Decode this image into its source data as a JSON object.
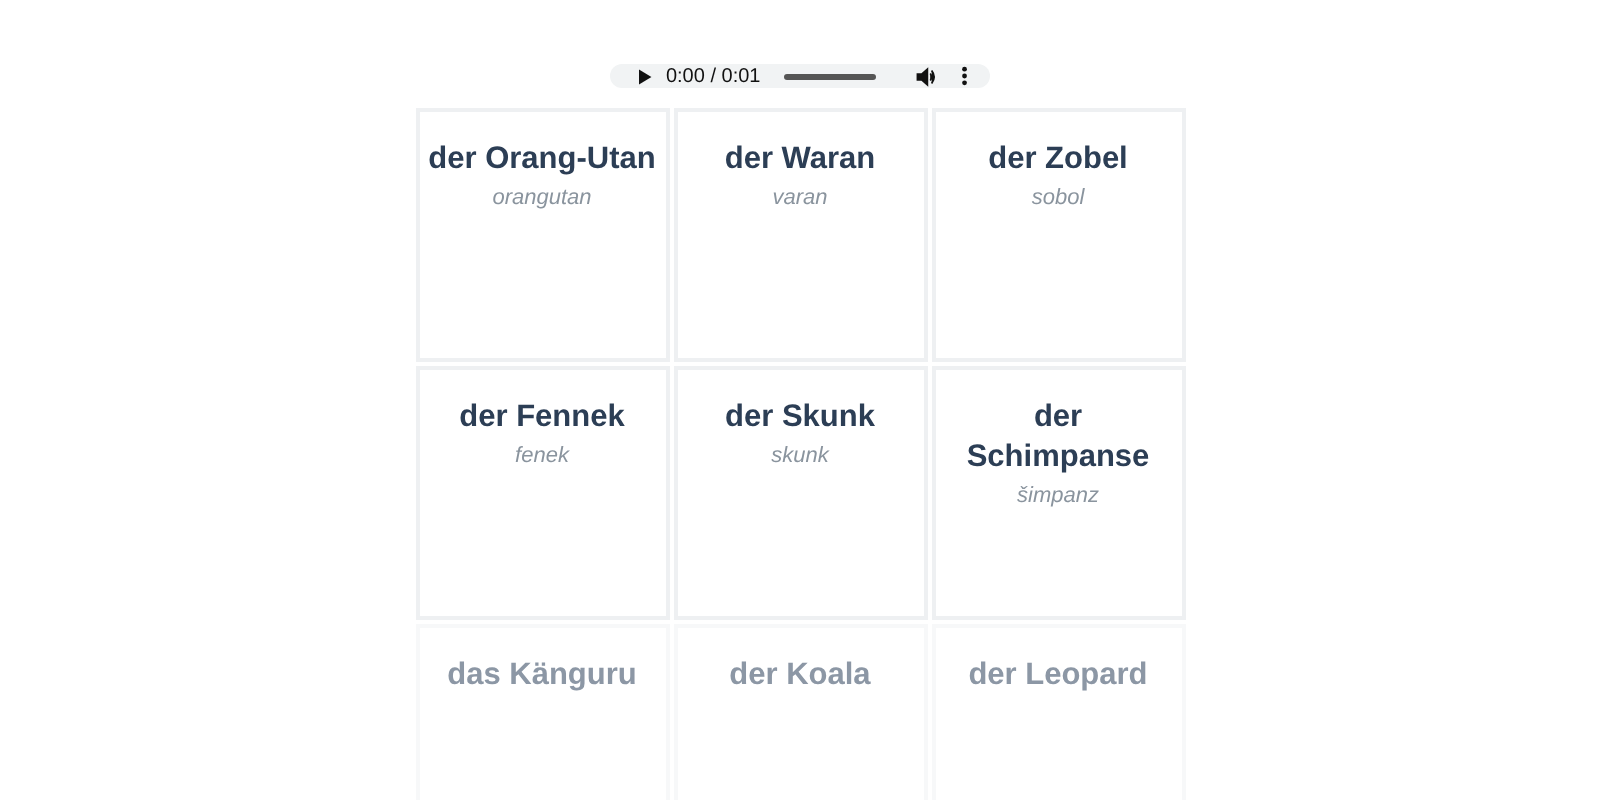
{
  "player": {
    "time": "0:00 / 0:01"
  },
  "cards": [
    {
      "word": "der Orang-Utan",
      "translation": "orangutan",
      "faded": false
    },
    {
      "word": "der Waran",
      "translation": "varan",
      "faded": false
    },
    {
      "word": "der Zobel",
      "translation": "sobol",
      "faded": false
    },
    {
      "word": "der Fennek",
      "translation": "fenek",
      "faded": false
    },
    {
      "word": "der Skunk",
      "translation": "skunk",
      "faded": false
    },
    {
      "word": "der Schimpanse",
      "translation": "šimpanz",
      "faded": false
    },
    {
      "word": "das Känguru",
      "faded": true
    },
    {
      "word": "der Koala",
      "faded": true
    },
    {
      "word": "der Leopard",
      "faded": true
    }
  ]
}
